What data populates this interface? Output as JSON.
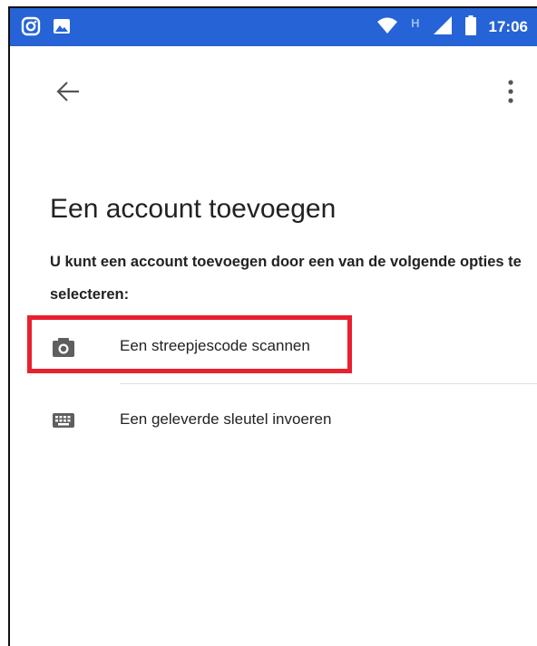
{
  "status_bar": {
    "time": "17:06",
    "network_label": "H",
    "icons": [
      "instagram-icon",
      "image-icon",
      "wifi-icon",
      "signal-icon",
      "battery-icon"
    ]
  },
  "app_bar": {
    "back_icon": "arrow-back-icon",
    "more_icon": "more-vert-icon"
  },
  "page": {
    "title": "Een account toevoegen",
    "description": "U kunt een account toevoegen door een van de volgende opties te selecteren:"
  },
  "options": [
    {
      "icon": "camera-icon",
      "label": "Een streepjescode scannen",
      "highlighted": true
    },
    {
      "icon": "keyboard-icon",
      "label": "Een geleverde sleutel invoeren",
      "highlighted": false
    }
  ],
  "colors": {
    "status_bar": "#2563d6",
    "highlight_border": "#e8202f",
    "icon_gray": "#5f5f5f"
  }
}
